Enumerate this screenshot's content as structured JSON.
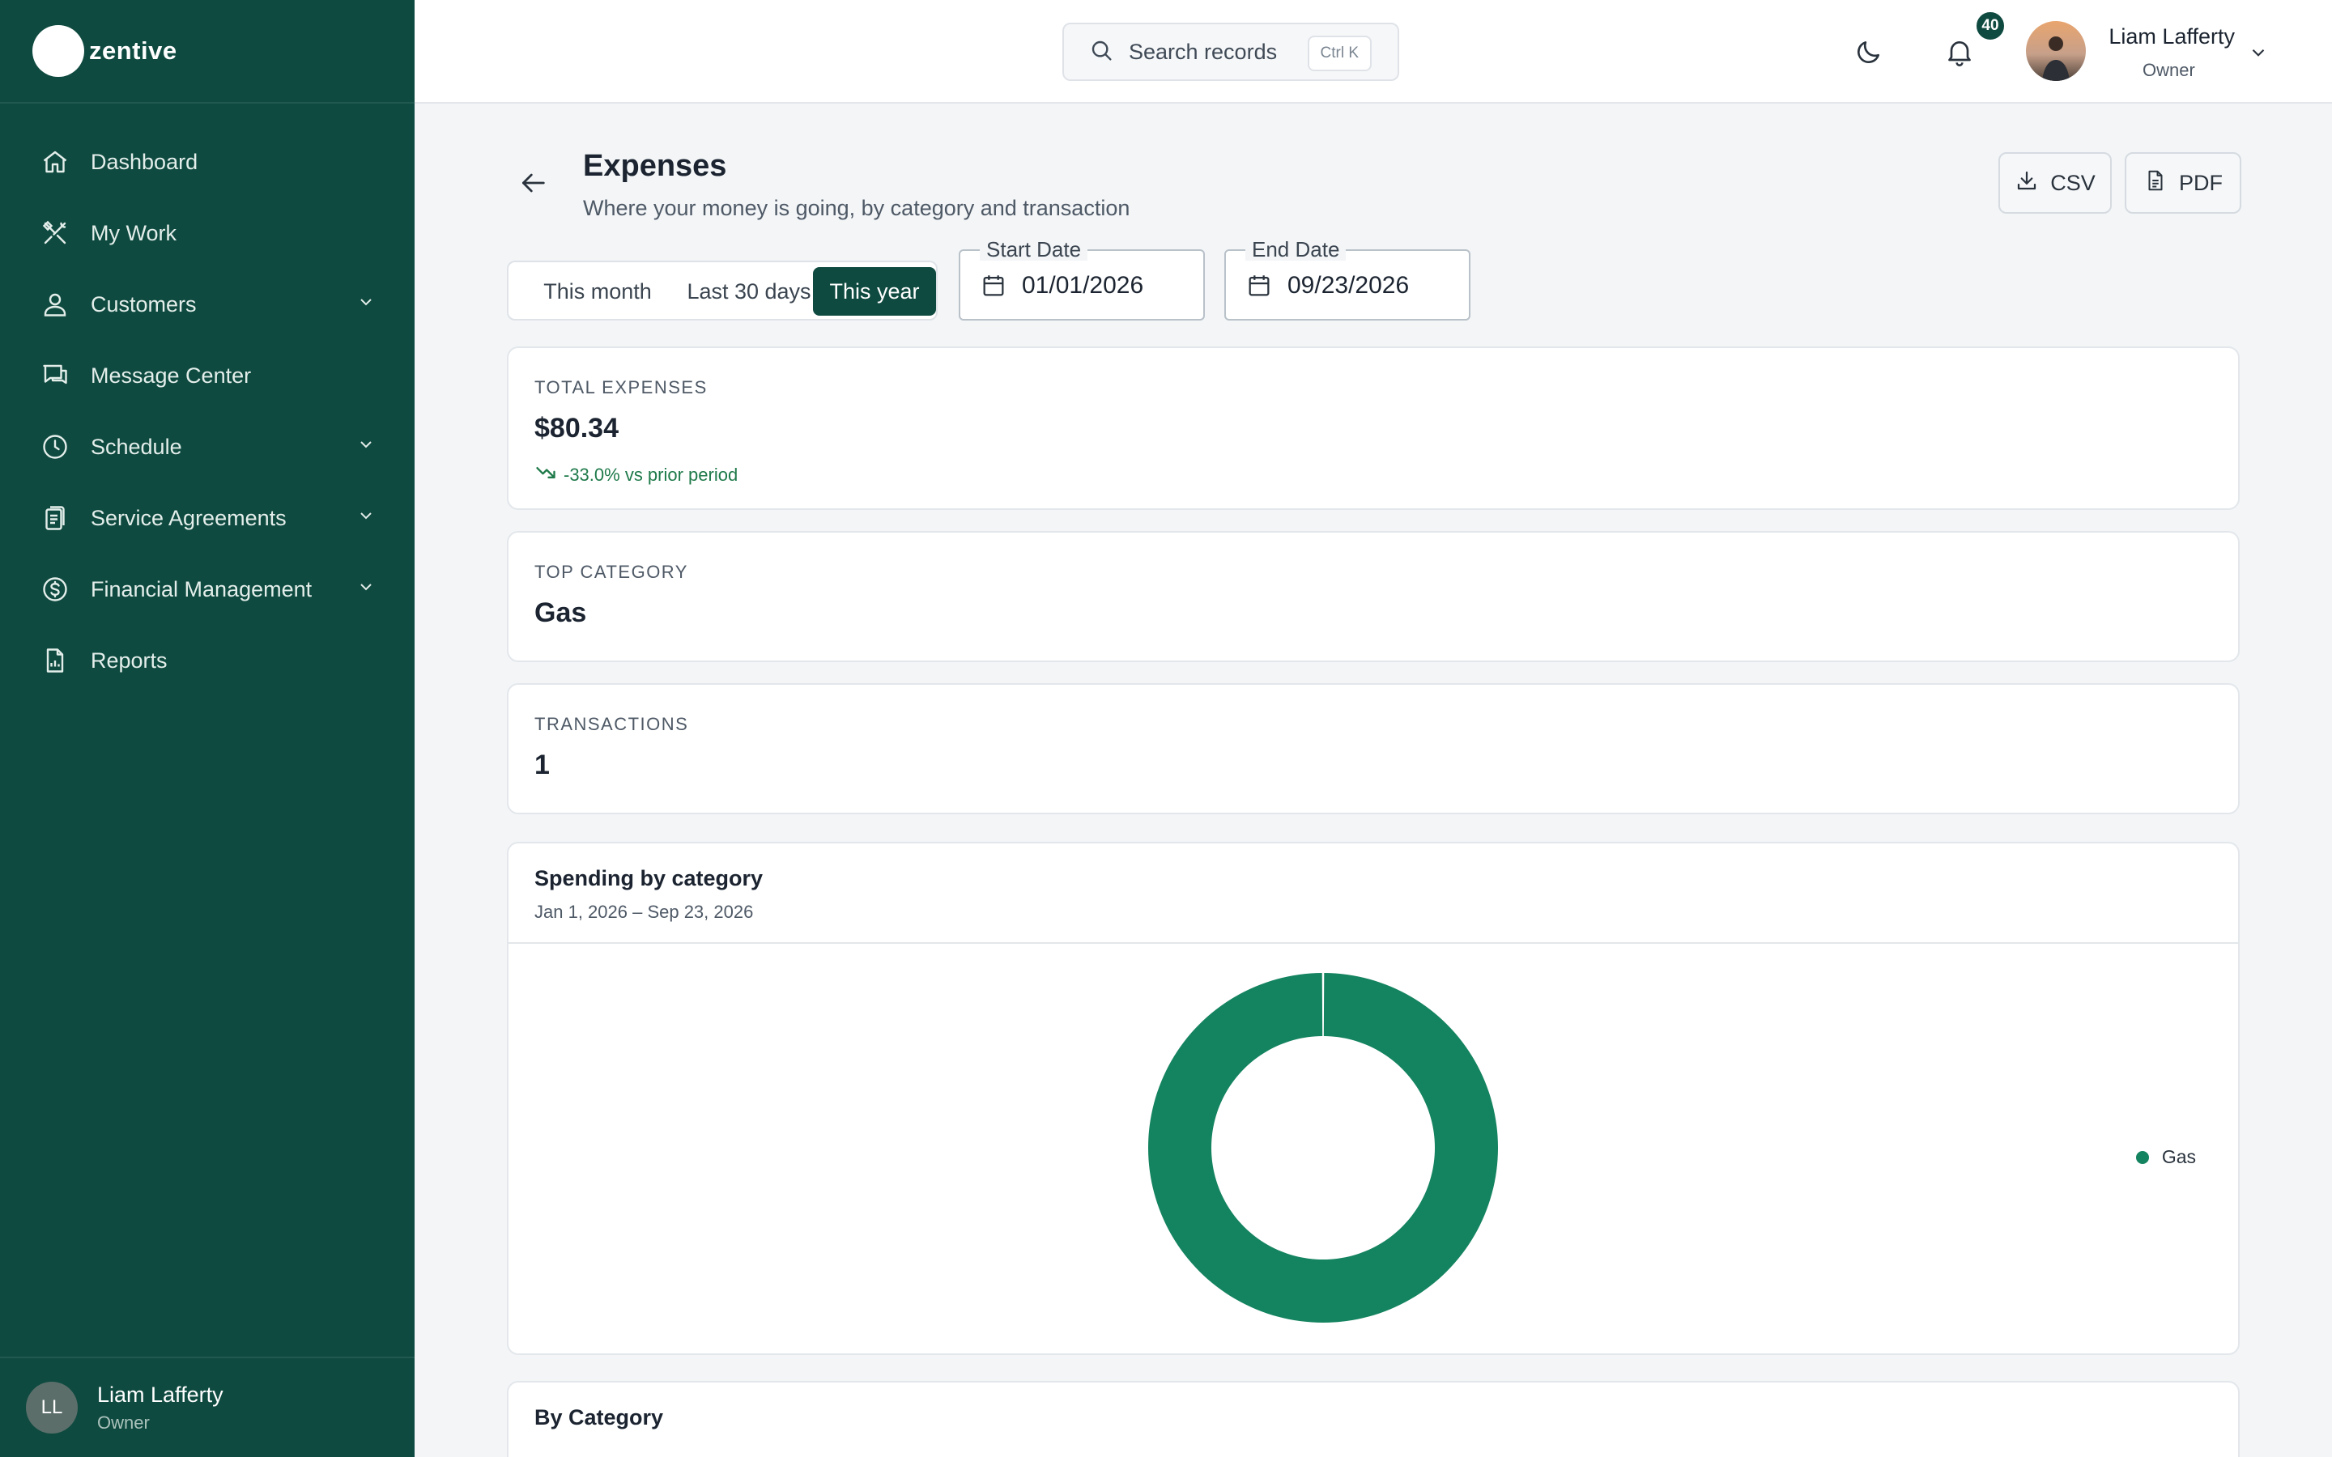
{
  "brand": {
    "name": "zentive"
  },
  "sidebar": {
    "items": [
      {
        "label": "Dashboard",
        "icon": "home-icon",
        "has_children": false
      },
      {
        "label": "My Work",
        "icon": "tools-icon",
        "has_children": false
      },
      {
        "label": "Customers",
        "icon": "users-icon",
        "has_children": true
      },
      {
        "label": "Message Center",
        "icon": "chat-icon",
        "has_children": false
      },
      {
        "label": "Schedule",
        "icon": "clock-icon",
        "has_children": true
      },
      {
        "label": "Service Agreements",
        "icon": "clipboard-icon",
        "has_children": true
      },
      {
        "label": "Financial Management",
        "icon": "dollar-icon",
        "has_children": true
      },
      {
        "label": "Reports",
        "icon": "report-icon",
        "has_children": false
      }
    ],
    "user": {
      "initials": "LL",
      "name": "Liam Lafferty",
      "role": "Owner"
    }
  },
  "topbar": {
    "search_placeholder": "Search records",
    "shortcut": "Ctrl K",
    "notification_count": "40",
    "user": {
      "name": "Liam Lafferty",
      "role": "Owner"
    }
  },
  "page": {
    "title": "Expenses",
    "subtitle": "Where your money is going, by category and transaction",
    "export_csv": "CSV",
    "export_pdf": "PDF"
  },
  "filters": {
    "ranges": [
      {
        "label": "This month",
        "active": false
      },
      {
        "label": "Last 30 days",
        "active": false
      },
      {
        "label": "This year",
        "active": true
      }
    ],
    "start_date": {
      "label": "Start Date",
      "value": "01/01/2026"
    },
    "end_date": {
      "label": "End Date",
      "value": "09/23/2026"
    }
  },
  "stats": {
    "total_expenses": {
      "label": "TOTAL EXPENSES",
      "value": "$80.34",
      "delta": "-33.0% vs prior period"
    },
    "top_category": {
      "label": "TOP CATEGORY",
      "value": "Gas"
    },
    "transactions": {
      "label": "TRANSACTIONS",
      "value": "1"
    }
  },
  "spending_chart": {
    "title": "Spending by category",
    "date_range": "Jan 1, 2026 – Sep 23, 2026"
  },
  "by_category": {
    "title": "By Category"
  },
  "colors": {
    "brand": "#0f4a40",
    "chart_gas": "#14835f",
    "positive_delta": "#1f7a4a"
  },
  "chart_data": {
    "type": "pie",
    "categories": [
      "Gas"
    ],
    "values": [
      80.34
    ],
    "colors": [
      "#14835f"
    ],
    "donut": true,
    "legend_position": "right"
  }
}
